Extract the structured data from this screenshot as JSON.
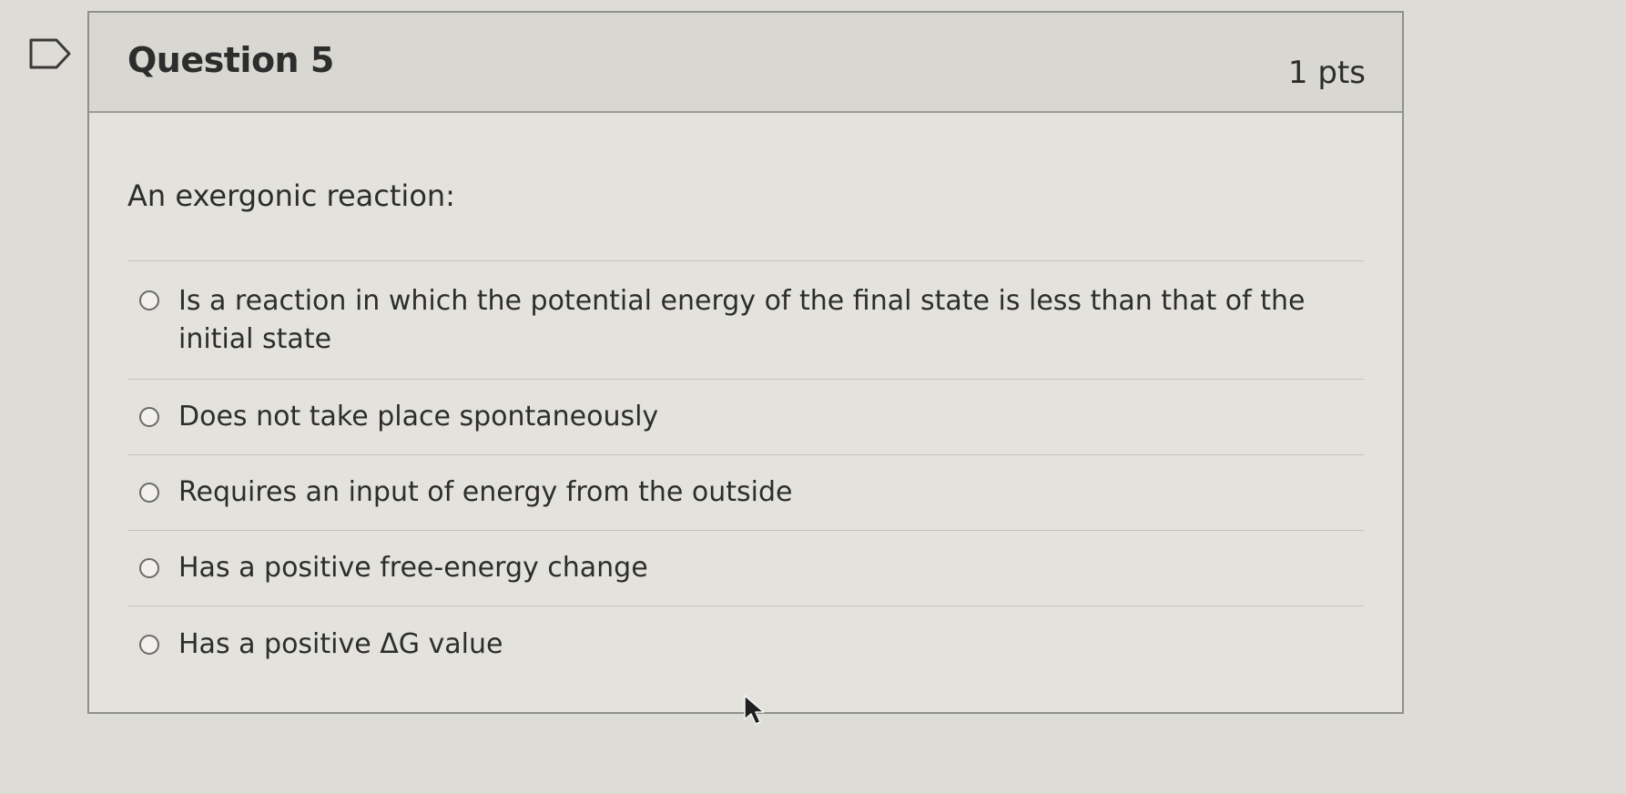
{
  "question": {
    "title": "Question 5",
    "points": "1 pts",
    "text": "An exergonic reaction:",
    "answers": [
      {
        "label": "Is a reaction in which the potential energy of the final state is less than that of the initial state",
        "selected": false
      },
      {
        "label": "Does not take place spontaneously",
        "selected": false
      },
      {
        "label": "Requires an input of energy from the outside",
        "selected": false
      },
      {
        "label": "Has a positive free-energy change",
        "selected": false
      },
      {
        "label": "Has a positive ΔG value",
        "selected": false
      }
    ]
  },
  "colors": {
    "page_background": "#dedcd6",
    "header_background": "#d8d7d2",
    "border": "#8f8f8c"
  },
  "icons": {
    "flag": "bookmark-flag-icon",
    "cursor": "mouse-pointer-icon"
  }
}
